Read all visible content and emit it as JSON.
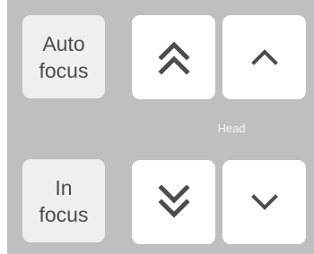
{
  "controls": {
    "auto_focus": {
      "line1": "Auto",
      "line2": "focus"
    },
    "in_focus": {
      "line1": "In",
      "line2": "focus"
    },
    "head_label": "Head"
  },
  "icons": {
    "fast_up": "double-chevron-up",
    "step_up": "chevron-up",
    "fast_down": "double-chevron-down",
    "step_down": "chevron-down"
  },
  "colors": {
    "panel_background": "#bfbfbf",
    "text_button_background": "#efefef",
    "arrow_button_background": "#ffffff",
    "text_color": "#4c4c4c",
    "head_label_color": "#f6f6f6"
  }
}
